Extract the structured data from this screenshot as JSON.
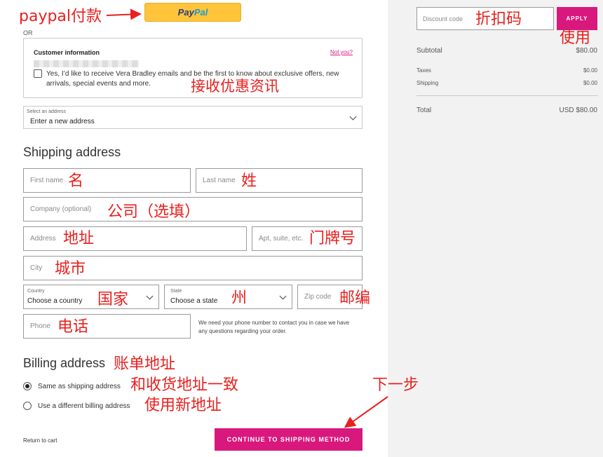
{
  "annotations": {
    "paypal_pay": "paypal付款",
    "receive_offers": "接收优惠资讯",
    "first_name": "名",
    "last_name": "姓",
    "company": "公司（选填）",
    "address": "地址",
    "apt": "门牌号",
    "city": "城市",
    "country": "国家",
    "state": "州",
    "zip": "邮编",
    "phone": "电话",
    "billing": "账单地址",
    "same_as_shipping": "和收货地址一致",
    "new_address": "使用新地址",
    "next_step": "下一步",
    "discount_code": "折扣码",
    "apply": "使用"
  },
  "paypal": {
    "logo_part1": "Pay",
    "logo_part2": "Pal",
    "brand_color": "#ffc439"
  },
  "or_label": "OR",
  "customer": {
    "title": "Customer information",
    "not_you": "Not you?",
    "opt_in_text": "Yes, I’d like to receive Vera Bradley emails and be the first to know about exclusive offers, new arrivals, special events and more."
  },
  "address_select": {
    "label": "Select an address",
    "value": "Enter a new address"
  },
  "shipping": {
    "title": "Shipping address",
    "first_name_ph": "First name",
    "last_name_ph": "Last name",
    "company_ph": "Company (optional)",
    "address_ph": "Address",
    "apt_ph": "Apt, suite, etc.",
    "city_ph": "City",
    "country_label": "Country",
    "country_value": "Choose a country",
    "state_label": "State",
    "state_value": "Choose a state",
    "zip_ph": "Zip code",
    "phone_ph": "Phone",
    "phone_note": "We need your phone number to contact you in case we have any questions regarding your order."
  },
  "billing": {
    "title": "Billing address",
    "same": "Same as shipping address",
    "different": "Use a different billing address"
  },
  "footer": {
    "return_link": "Return to cart",
    "continue_label": "CONTINUE TO SHIPPING METHOD"
  },
  "summary": {
    "discount_ph": "Discount code",
    "apply_label": "APPLY",
    "subtotal_label": "Subtotal",
    "subtotal_value": "$80.00",
    "taxes_label": "Taxes",
    "taxes_value": "$0.00",
    "shipping_label": "Shipping",
    "shipping_value": "$0.00",
    "total_label": "Total",
    "total_currency": "USD",
    "total_value": "$80.00"
  },
  "colors": {
    "accent": "#d9187e",
    "annotation": "#e8201e",
    "sidebar_bg": "#f2f2f2"
  }
}
